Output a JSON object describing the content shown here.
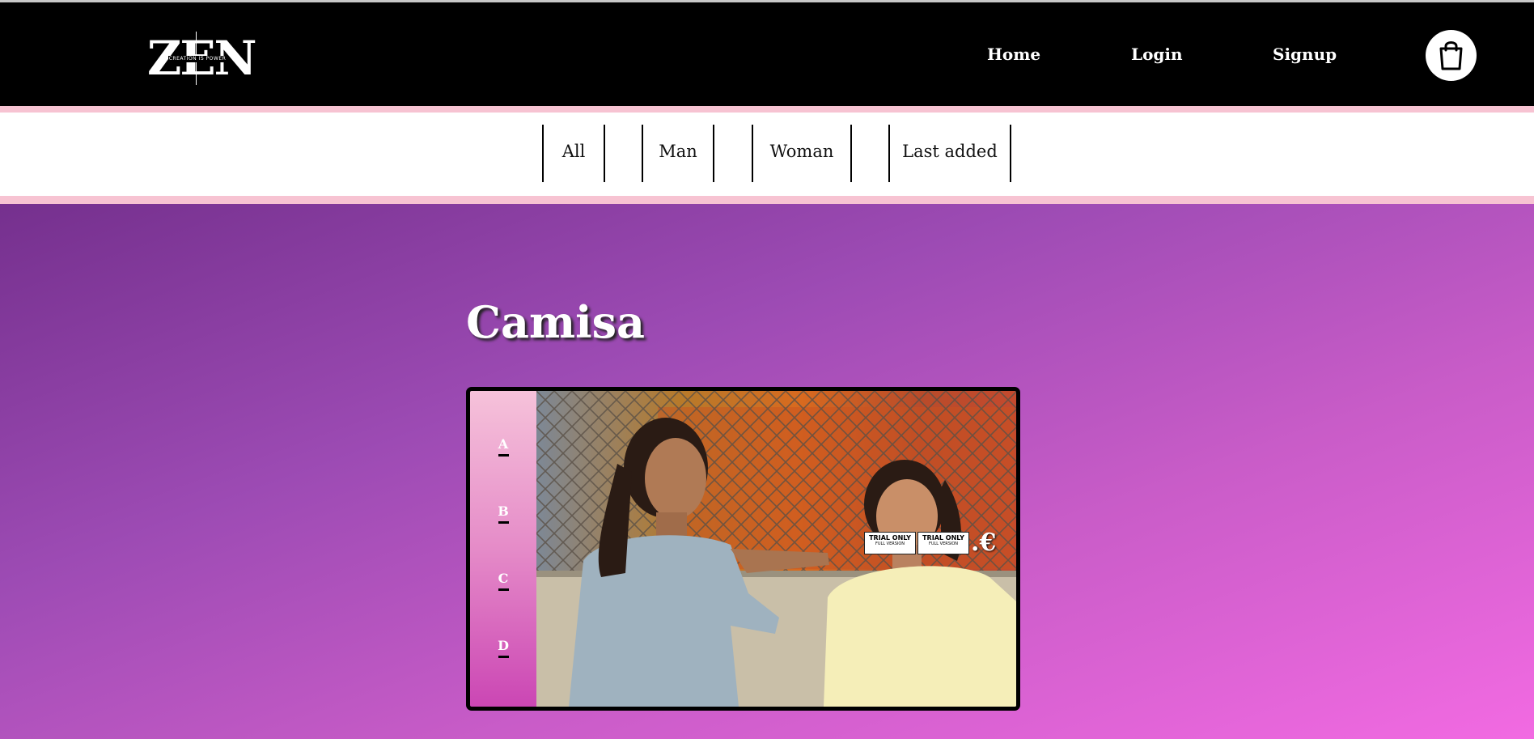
{
  "header": {
    "logo": {
      "text": "ZEN",
      "tagline": "CREATION IS POWER"
    },
    "nav": {
      "home": "Home",
      "login": "Login",
      "signup": "Signup"
    },
    "cart_icon": "shopping-bag-icon"
  },
  "categories": [
    "All",
    "Man",
    "Woman",
    "Last added"
  ],
  "product": {
    "title": "Camisa",
    "sizes": [
      "A",
      "B",
      "C",
      "D"
    ],
    "price_suffix": ".€",
    "watermark": {
      "label": "TRIAL ONLY",
      "sub": "FULL VERSION"
    },
    "image_alt": "photo-two-girls-by-fence"
  },
  "colors": {
    "header_bg": "#000000",
    "accent_pink": "#f7c3d2",
    "gradient_start": "#75308e",
    "gradient_end": "#f26ae2"
  }
}
